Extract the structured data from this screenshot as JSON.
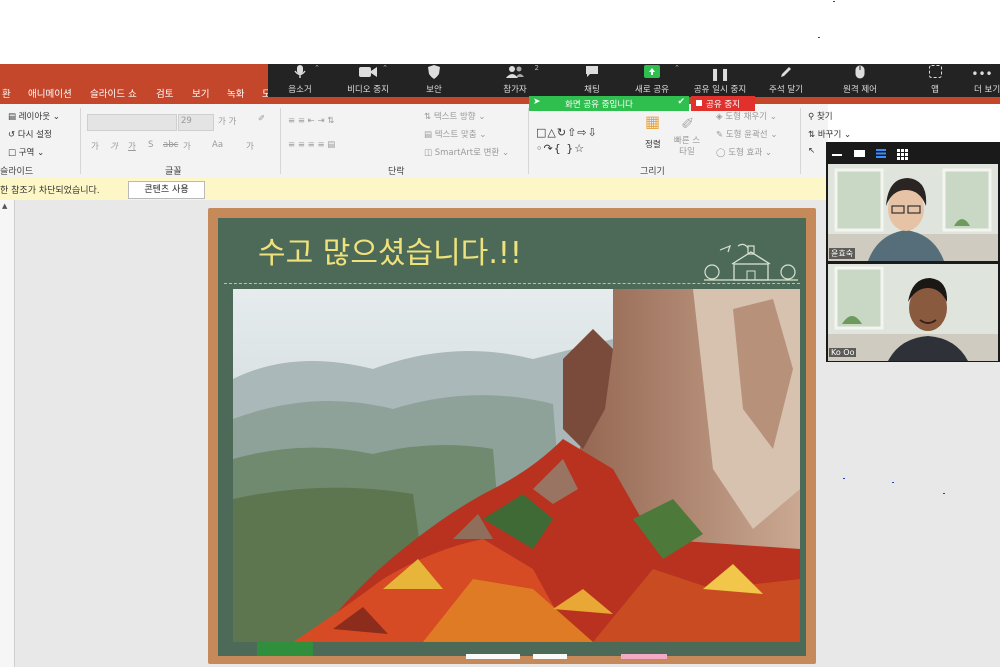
{
  "ribbon_tabs": [
    "환",
    "애니메이션",
    "슬라이드 쇼",
    "검토",
    "보기",
    "녹화",
    "도"
  ],
  "zoom_toolbar": {
    "items": [
      {
        "label": "음소거",
        "icon": "microphone-icon"
      },
      {
        "label": "비디오 중지",
        "icon": "video-camera-icon"
      },
      {
        "label": "보안",
        "icon": "shield-icon"
      },
      {
        "label": "참가자",
        "icon": "participants-icon",
        "count": "2"
      },
      {
        "label": "채팅",
        "icon": "chat-icon"
      },
      {
        "label": "새로 공유",
        "icon": "share-screen-icon"
      },
      {
        "label": "공유 일시 중지",
        "icon": "pause-icon"
      },
      {
        "label": "주석 달기",
        "icon": "pen-icon"
      },
      {
        "label": "원격 제어",
        "icon": "mouse-icon"
      },
      {
        "label": "앱",
        "icon": "apps-icon"
      },
      {
        "label": "더 보기",
        "icon": "more-icon"
      }
    ],
    "accent_green": "#2fbf4f",
    "stop_red": "#e0312d"
  },
  "share_bar": {
    "status": "화면 공유 중입니다",
    "stop_label": "공유 중지"
  },
  "ribbon": {
    "slides": {
      "layout": "레이아웃",
      "reset": "다시 설정",
      "section": "구역",
      "group": "슬라이드"
    },
    "font": {
      "size": "29",
      "bold": "가",
      "italic": "가",
      "underline": "가",
      "strike": "S",
      "spacing": "abc",
      "case": "가",
      "clear": "Aa",
      "color": "가",
      "group": "글꼴"
    },
    "paragraph": {
      "text_direction": "텍스트 방향",
      "align_text": "텍스트 맞춤",
      "smartart": "SmartArt로 변환",
      "group": "단락"
    },
    "drawing": {
      "arrange": "정렬",
      "quick_styles": "빠른 스타일",
      "shape_fill": "도형 채우기",
      "shape_outline": "도형 윤곽선",
      "shape_effects": "도형 효과",
      "group": "그리기"
    },
    "editing": {
      "find": "찾기",
      "replace": "바꾸기"
    }
  },
  "message_bar": {
    "text": "한 참조가 차단되었습니다.",
    "button": "콘텐츠 사용"
  },
  "slide": {
    "title": "수고 많으셨습니다.!!"
  },
  "participants": [
    {
      "name": "윤효숙"
    },
    {
      "name": "Ko Oo"
    }
  ],
  "colors": {
    "ppt_red": "#c4472c",
    "chalkboard": "#4d6a58",
    "frame": "#c5895a",
    "title_yellow": "#f0e27a"
  }
}
